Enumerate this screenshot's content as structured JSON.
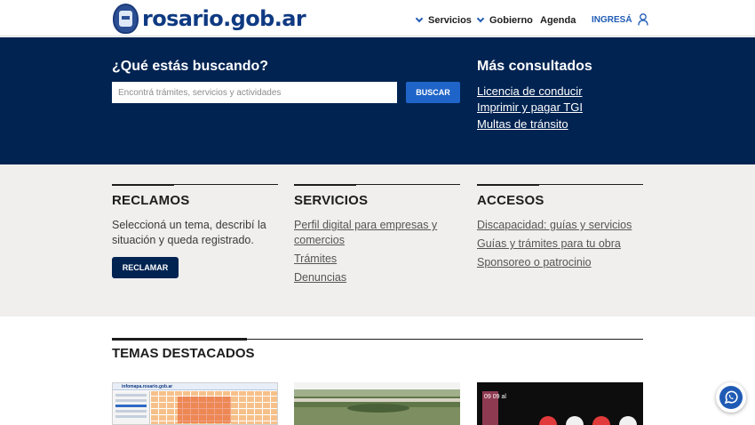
{
  "header": {
    "logo_text": "rosario.gob.ar",
    "nav": [
      {
        "label": "Servicios"
      },
      {
        "label": "Gobierno"
      },
      {
        "label": "Agenda"
      }
    ],
    "login_label": "INGRESÁ"
  },
  "hero": {
    "search_title": "¿Qué estás buscando?",
    "search_placeholder": "Encontrá trámites, servicios y actividades",
    "search_button": "BUSCAR",
    "popular_title": "Más consultados",
    "popular_links": [
      "Licencia de conducir",
      "Imprimir y pagar TGI",
      "Multas de tránsito"
    ]
  },
  "sections": {
    "reclamos": {
      "title": "RECLAMOS",
      "text": "Seleccioná un tema, describí la situación y queda registrado.",
      "button": "RECLAMAR"
    },
    "servicios": {
      "title": "SERVICIOS",
      "links": [
        "Perfil digital para empresas y comercios",
        "Trámites",
        "Denuncias"
      ]
    },
    "accesos": {
      "title": "ACCESOS",
      "links": [
        "Discapacidad: guías y servicios",
        "Guías y trámites para tu obra",
        "Sponsoreo o patrocinio"
      ]
    }
  },
  "featured": {
    "title": "TEMAS DESTACADOS",
    "card_map_header": "infomapa.rosario.gob.ar",
    "card_event_date": "09 09 al"
  },
  "colors": {
    "brand_dark": "#002352",
    "accent_blue": "#1f64c8",
    "gray_section": "#f0efee"
  },
  "icons": {
    "logo": "rosario-seal-icon",
    "nav_chevron": "chevron-down-icon",
    "login": "user-icon",
    "chat": "whatsapp-icon"
  }
}
